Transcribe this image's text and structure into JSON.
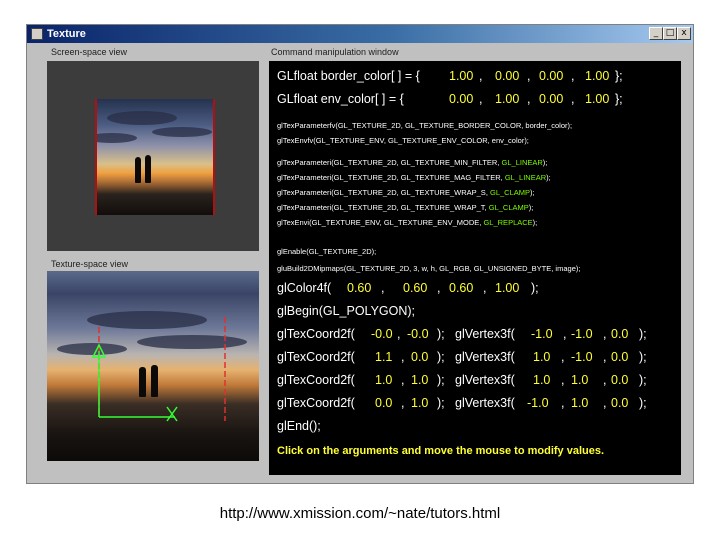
{
  "window": {
    "title": "Texture",
    "minimize": "_",
    "maximize": "□",
    "close": "x"
  },
  "screen_panel": {
    "label": "Screen-space view"
  },
  "texture_panel": {
    "label": "Texture-space view"
  },
  "command_panel": {
    "label": "Command manipulation window",
    "border_color": {
      "prefix": "GLfloat border_color[ ] = {",
      "values": [
        "1.00",
        "0.00",
        "0.00",
        "1.00"
      ],
      "suffix": "};"
    },
    "env_color": {
      "prefix": "GLfloat env_color[ ] = {",
      "values": [
        "0.00",
        "1.00",
        "0.00",
        "1.00"
      ],
      "suffix": "};"
    },
    "param_lines": [
      "glTexParameterfv(GL_TEXTURE_2D, GL_TEXTURE_BORDER_COLOR, border_color);",
      "glTexEnvfv(GL_TEXTURE_ENV, GL_TEXTURE_ENV_COLOR, env_color);"
    ],
    "tex_params": [
      {
        "text": "glTexParameteri(GL_TEXTURE_2D, GL_TEXTURE_MIN_FILTER, ",
        "value": "GL_LINEAR",
        "end": ");"
      },
      {
        "text": "glTexParameteri(GL_TEXTURE_2D, GL_TEXTURE_MAG_FILTER, ",
        "value": "GL_LINEAR",
        "end": ");"
      },
      {
        "text": "glTexParameteri(GL_TEXTURE_2D, GL_TEXTURE_WRAP_S, ",
        "value": "GL_CLAMP",
        "end": ");"
      },
      {
        "text": "glTexParameteri(GL_TEXTURE_2D, GL_TEXTURE_WRAP_T, ",
        "value": "GL_CLAMP",
        "end": ");"
      },
      {
        "text": "glTexEnvi(GL_TEXTURE_ENV, GL_TEXTURE_ENV_MODE, ",
        "value": "GL_REPLACE",
        "end": ");"
      }
    ],
    "enable_line": "glEnable(GL_TEXTURE_2D);",
    "mipmaps_line": "gluBuild2DMipmaps(GL_TEXTURE_2D, 3, w, h, GL_RGB, GL_UNSIGNED_BYTE, image);",
    "color": {
      "prefix": "glColor4f(",
      "values": [
        "0.60",
        "0.60",
        "0.60",
        "1.00"
      ],
      "suffix": ");"
    },
    "begin": "glBegin(GL_POLYGON);",
    "vertices": [
      {
        "tc": [
          "-0.0",
          "-0.0"
        ],
        "v": [
          "-1.0",
          "-1.0",
          "0.0"
        ]
      },
      {
        "tc": [
          "1.1",
          "0.0"
        ],
        "v": [
          "1.0",
          "-1.0",
          "0.0"
        ]
      },
      {
        "tc": [
          "1.0",
          "1.0"
        ],
        "v": [
          "1.0",
          "1.0",
          "0.0"
        ]
      },
      {
        "tc": [
          "0.0",
          "1.0"
        ],
        "v": [
          "-1.0",
          "1.0",
          "0.0"
        ]
      }
    ],
    "tex_prefix": "glTexCoord2f(",
    "vert_prefix": "glVertex3f(",
    "end": "glEnd();",
    "hint": "Click on the arguments and move the mouse to modify values."
  },
  "url": "http://www.xmission.com/~nate/tutors.html"
}
